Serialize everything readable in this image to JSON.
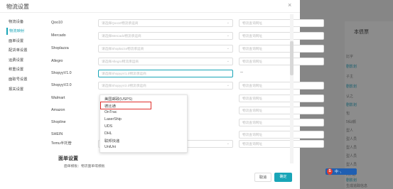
{
  "modal": {
    "title": "物流设置",
    "close": "×"
  },
  "side_nav": [
    {
      "label": "物流设备",
      "active": false
    },
    {
      "label": "物流映射",
      "active": true
    },
    {
      "label": "面单设置",
      "active": false
    },
    {
      "label": "配货单设置",
      "active": false
    },
    {
      "label": "运费设置",
      "active": false
    },
    {
      "label": "称重设置",
      "active": false
    },
    {
      "label": "面取号设置",
      "active": false
    },
    {
      "label": "报关设置",
      "active": false
    }
  ],
  "rows": [
    {
      "label": "Qoo10",
      "select_placeholder": "请选择Qoo10物流承运商",
      "url_placeholder": "物流查询网址"
    },
    {
      "label": "Mercado",
      "select_placeholder": "请选择Mercado物流承运商",
      "url_placeholder": "物流查询网址"
    },
    {
      "label": "Shoplazza",
      "select_placeholder": "请选择Shoplazza物流承运商",
      "url_placeholder": "物流查询网址"
    },
    {
      "label": "Allegro",
      "select_placeholder": "请选择Allegro物流承运商",
      "url_placeholder": "物流查询网址"
    },
    {
      "label": "ShopyyV1.0",
      "select_placeholder": "请选择ShopyyV1.0物流承运商",
      "url_placeholder": "--"
    },
    {
      "label": "ShopyyV2.0",
      "select_placeholder": "请选择ShopyyV2.0物流承运商",
      "url_placeholder": "物流查询网址"
    },
    {
      "label": "Walmart",
      "select_placeholder": "",
      "url_placeholder": "物流查询网址"
    },
    {
      "label": "Amazon",
      "select_placeholder": "",
      "url_placeholder": "物流查询网址"
    },
    {
      "label": "Shopline",
      "select_placeholder": "",
      "url_placeholder": "物流查询网址"
    },
    {
      "label": "SHEIN",
      "select_placeholder": "",
      "url_placeholder": "物流查询网址"
    },
    {
      "label": "Temu半托管",
      "select_placeholder": "请选择Temu半托管物流承运商",
      "url_placeholder": "物流查询网址"
    }
  ],
  "dropdown": {
    "options": [
      "美国邮政(USPS)",
      "德比通",
      "OnTrac",
      "LaserShip",
      "UDS",
      "DHL",
      "联邦快递",
      "UniUni"
    ],
    "highlighted_index": 1
  },
  "section": {
    "title": "面单设置",
    "subtitle": "面单模板：物流面单或模板"
  },
  "buttons": {
    "cancel": "取消",
    "confirm": "确定"
  },
  "background_right": {
    "title": "本债票",
    "rows": [
      "比字",
      "剧影划",
      "子主",
      "剧影划",
      "认之",
      "剧影划",
      "包",
      "5仙/颜",
      "型人",
      "型人员",
      "型人员",
      "型人员",
      "型人员",
      "A开始",
      "剧影划",
      "生成追踪信息"
    ]
  },
  "ime": {
    "logo": "S",
    "text": "中 ·,"
  },
  "colors": {
    "accent": "#19a5b7",
    "highlight_box": "#e0302d"
  }
}
